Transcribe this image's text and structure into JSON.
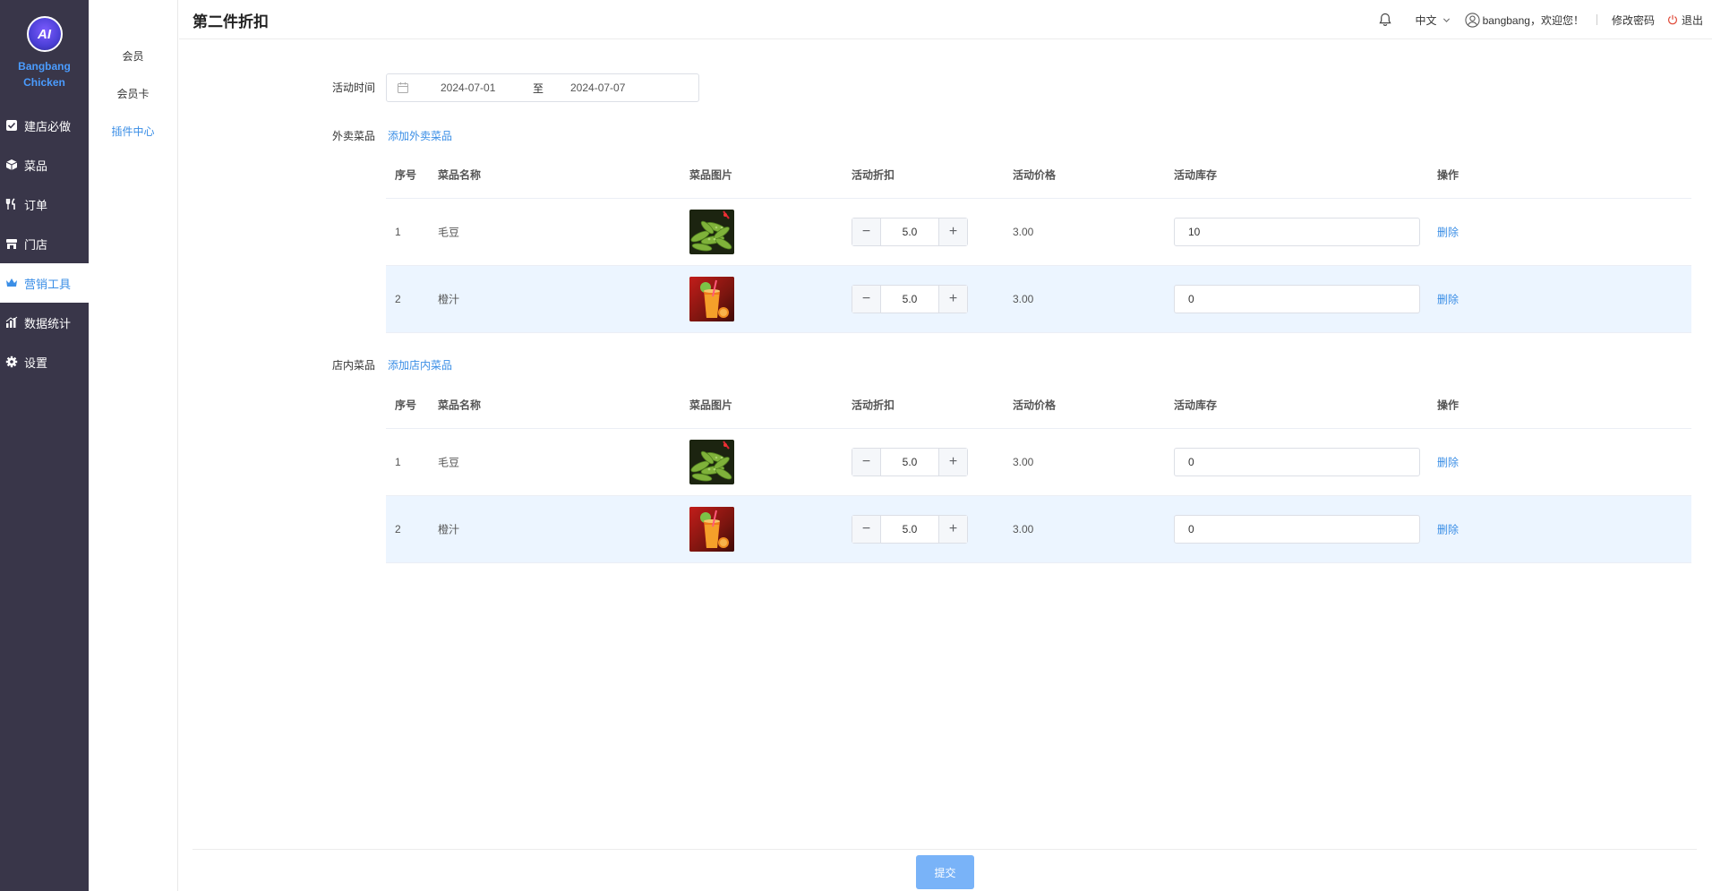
{
  "brand": {
    "logo_text": "AI",
    "name": "Bangbang Chicken"
  },
  "sidebar": {
    "items": [
      {
        "label": "建店必做",
        "icon": "checklist-icon",
        "active": false
      },
      {
        "label": "菜品",
        "icon": "box-icon",
        "active": false
      },
      {
        "label": "订单",
        "icon": "fork-knife-icon",
        "active": false
      },
      {
        "label": "门店",
        "icon": "store-icon",
        "active": false
      },
      {
        "label": "营销工具",
        "icon": "crown-icon",
        "active": true
      },
      {
        "label": "数据统计",
        "icon": "bar-chart-icon",
        "active": false
      },
      {
        "label": "设置",
        "icon": "gear-icon",
        "active": false
      }
    ]
  },
  "subnav": {
    "items": [
      {
        "label": "会员",
        "active": false
      },
      {
        "label": "会员卡",
        "active": false
      },
      {
        "label": "插件中心",
        "active": true
      }
    ]
  },
  "header": {
    "title": "第二件折扣",
    "language": "中文",
    "greeting": "bangbang，欢迎您！",
    "change_password": "修改密码",
    "logout": "退出"
  },
  "form": {
    "activity_time_label": "活动时间",
    "date_start": "2024-07-01",
    "date_sep": "至",
    "date_end": "2024-07-07"
  },
  "takeout": {
    "label": "外卖菜品",
    "add_link": "添加外卖菜品",
    "rows": [
      {
        "idx": "1",
        "name": "毛豆",
        "img": "edamame",
        "discount": "5.0",
        "price": "3.00",
        "stock": "10",
        "op": "删除"
      },
      {
        "idx": "2",
        "name": "橙汁",
        "img": "juice",
        "discount": "5.0",
        "price": "3.00",
        "stock": "0",
        "op": "删除"
      }
    ]
  },
  "dinein": {
    "label": "店内菜品",
    "add_link": "添加店内菜品",
    "rows": [
      {
        "idx": "1",
        "name": "毛豆",
        "img": "edamame",
        "discount": "5.0",
        "price": "3.00",
        "stock": "0",
        "op": "删除"
      },
      {
        "idx": "2",
        "name": "橙汁",
        "img": "juice",
        "discount": "5.0",
        "price": "3.00",
        "stock": "0",
        "op": "删除"
      }
    ]
  },
  "table_headers": {
    "idx": "序号",
    "name": "菜品名称",
    "img": "菜品图片",
    "discount": "活动折扣",
    "price": "活动价格",
    "stock": "活动库存",
    "op": "操作"
  },
  "footer": {
    "submit": "提交"
  },
  "colors": {
    "sidebar_bg": "#393649",
    "accent": "#3a8ee6",
    "row_highlight": "#ecf5ff",
    "submit_bg": "#79b3f8"
  }
}
